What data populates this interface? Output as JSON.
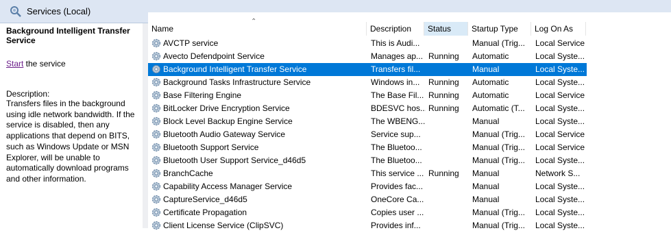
{
  "header": {
    "title": "Services (Local)",
    "icon": "magnifier-gear-icon"
  },
  "detail": {
    "service_name": "Background Intelligent Transfer Service",
    "action_link": "Start",
    "action_suffix": " the service",
    "description_label": "Description:",
    "description": "Transfers files in the background using idle network bandwidth. If the service is disabled, then any applications that depend on BITS, such as Windows Update or MSN Explorer, will be unable to automatically download programs and other information."
  },
  "columns": {
    "name": "Name",
    "description": "Description",
    "status": "Status",
    "startup": "Startup Type",
    "logon": "Log On As"
  },
  "selected_row": 2,
  "rows": [
    {
      "name": "AVCTP service",
      "description": "This is Audi...",
      "status": "",
      "startup": "Manual (Trig...",
      "logon": "Local Service"
    },
    {
      "name": "Avecto Defendpoint Service",
      "description": "Manages ap...",
      "status": "Running",
      "startup": "Automatic",
      "logon": "Local Syste..."
    },
    {
      "name": "Background Intelligent Transfer Service",
      "description": "Transfers fil...",
      "status": "",
      "startup": "Manual",
      "logon": "Local Syste..."
    },
    {
      "name": "Background Tasks Infrastructure Service",
      "description": "Windows in...",
      "status": "Running",
      "startup": "Automatic",
      "logon": "Local Syste..."
    },
    {
      "name": "Base Filtering Engine",
      "description": "The Base Fil...",
      "status": "Running",
      "startup": "Automatic",
      "logon": "Local Service"
    },
    {
      "name": "BitLocker Drive Encryption Service",
      "description": "BDESVC hos...",
      "status": "Running",
      "startup": "Automatic (T...",
      "logon": "Local Syste..."
    },
    {
      "name": "Block Level Backup Engine Service",
      "description": "The WBENG...",
      "status": "",
      "startup": "Manual",
      "logon": "Local Syste..."
    },
    {
      "name": "Bluetooth Audio Gateway Service",
      "description": "Service sup...",
      "status": "",
      "startup": "Manual (Trig...",
      "logon": "Local Service"
    },
    {
      "name": "Bluetooth Support Service",
      "description": "The Bluetoo...",
      "status": "",
      "startup": "Manual (Trig...",
      "logon": "Local Service"
    },
    {
      "name": "Bluetooth User Support Service_d46d5",
      "description": "The Bluetoo...",
      "status": "",
      "startup": "Manual (Trig...",
      "logon": "Local Syste..."
    },
    {
      "name": "BranchCache",
      "description": "This service ...",
      "status": "Running",
      "startup": "Manual",
      "logon": "Network S..."
    },
    {
      "name": "Capability Access Manager Service",
      "description": "Provides fac...",
      "status": "",
      "startup": "Manual",
      "logon": "Local Syste..."
    },
    {
      "name": "CaptureService_d46d5",
      "description": "OneCore Ca...",
      "status": "",
      "startup": "Manual",
      "logon": "Local Syste..."
    },
    {
      "name": "Certificate Propagation",
      "description": "Copies user ...",
      "status": "",
      "startup": "Manual (Trig...",
      "logon": "Local Syste..."
    },
    {
      "name": "Client License Service (ClipSVC)",
      "description": "Provides inf...",
      "status": "",
      "startup": "Manual (Trig...",
      "logon": "Local Syste..."
    }
  ],
  "colors": {
    "selection": "#0078d7",
    "header_bg": "#dde6f3",
    "link": "#6c1f8a",
    "sorted_col": "#d9eaf7"
  }
}
